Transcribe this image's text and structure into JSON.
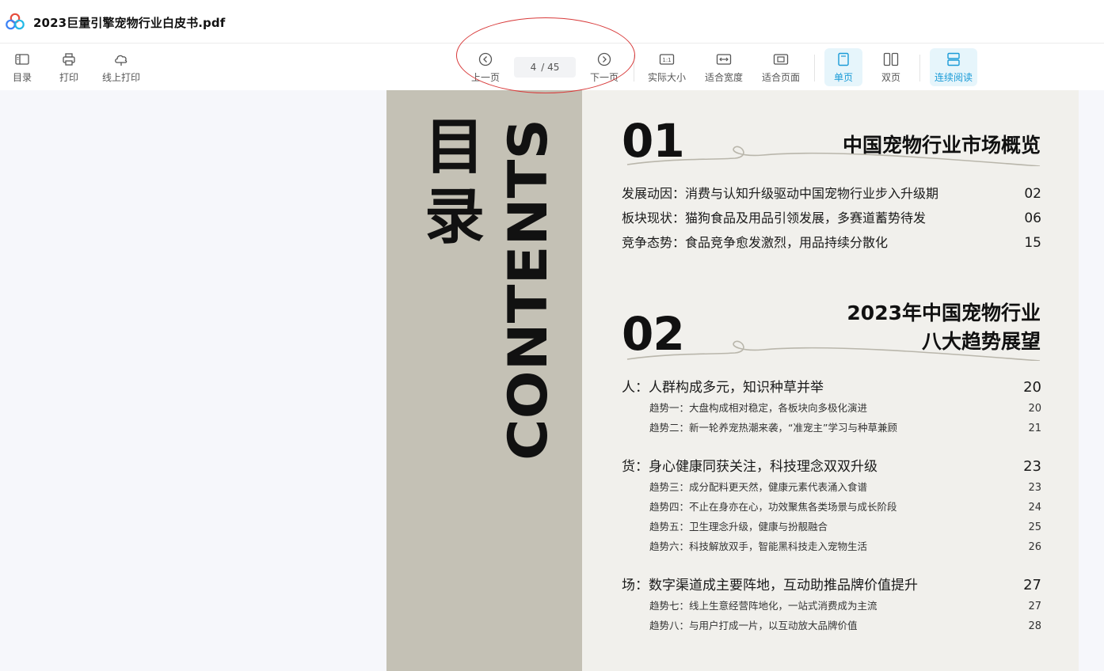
{
  "app": {
    "file_name": "2023巨量引擎宠物行业白皮书.pdf"
  },
  "toolbar": {
    "toc_label": "目录",
    "print_label": "打印",
    "online_print_label": "线上打印",
    "prev_label": "上一页",
    "next_label": "下一页",
    "current_page": "4",
    "total_pages": "/ 45",
    "actual_size_label": "实际大小",
    "fit_width_label": "适合宽度",
    "fit_page_label": "适合页面",
    "single_label": "单页",
    "double_label": "双页",
    "continuous_label": "连续阅读",
    "actual_size_glyph": "1:1",
    "accent_color": "#1a9bd7"
  },
  "pdf": {
    "mulu": "目录",
    "contents": "CONTENTS",
    "sections": [
      {
        "num": "01",
        "title_line1": "中国宠物行业市场概览",
        "title_line2": "",
        "entries": [
          {
            "text": "发展动因：消费与认知升级驱动中国宠物行业步入升级期",
            "page": "02"
          },
          {
            "text": "板块现状：猫狗食品及用品引领发展，多赛道蓄势待发",
            "page": "06"
          },
          {
            "text": "竞争态势：食品竞争愈发激烈，用品持续分散化",
            "page": "15"
          }
        ]
      },
      {
        "num": "02",
        "title_line1": "2023年中国宠物行业",
        "title_line2": "八大趋势展望",
        "groups": [
          {
            "text": "人：人群构成多元，知识种草并举",
            "page": "20",
            "items": [
              {
                "text": "趋势一：大盘构成相对稳定，各板块向多极化演进",
                "page": "20"
              },
              {
                "text": "趋势二：新一轮养宠热潮来袭，“准宠主”学习与种草兼顾",
                "page": "21"
              }
            ]
          },
          {
            "text": "货：身心健康同获关注，科技理念双双升级",
            "page": "23",
            "items": [
              {
                "text": "趋势三：成分配料更天然，健康元素代表涌入食谱",
                "page": "23"
              },
              {
                "text": "趋势四：不止在身亦在心，功效聚焦各类场景与成长阶段",
                "page": "24"
              },
              {
                "text": "趋势五：卫生理念升级，健康与扮靓融合",
                "page": "25"
              },
              {
                "text": "趋势六：科技解放双手，智能黑科技走入宠物生活",
                "page": "26"
              }
            ]
          },
          {
            "text": "场：数字渠道成主要阵地，互动助推品牌价值提升",
            "page": "27",
            "items": [
              {
                "text": "趋势七：线上生意经营阵地化，一站式消费成为主流",
                "page": "27"
              },
              {
                "text": "趋势八：与用户打成一片，以互动放大品牌价值",
                "page": "28"
              }
            ]
          }
        ]
      }
    ],
    "band_color": "#c4c1b5",
    "page_color": "#f1f0ec"
  },
  "annotation": {
    "color": "#d83a3a"
  }
}
